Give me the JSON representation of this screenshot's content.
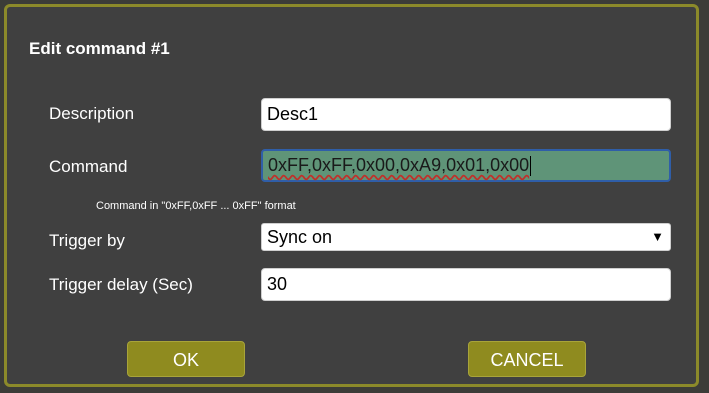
{
  "dialog": {
    "title": "Edit command #1",
    "fields": {
      "description": {
        "label": "Description",
        "value": "Desc1"
      },
      "command": {
        "label": "Command",
        "value": "0xFF,0xFF,0x00,0xA9,0x01,0x00",
        "hint": "Command in \"0xFF,0xFF ... 0xFF\" format"
      },
      "trigger_by": {
        "label": "Trigger by",
        "value": "Sync on"
      },
      "trigger_delay": {
        "label": "Trigger delay (Sec)",
        "value": "30"
      }
    },
    "buttons": {
      "ok": "OK",
      "cancel": "CANCEL"
    }
  },
  "colors": {
    "accent": "#8f8b1f",
    "dialog_bg": "#404040",
    "command_field_bg": "#5f9478",
    "focus_border": "#2f5ea8"
  },
  "icons": {
    "select_arrow": "chevron-down-icon"
  }
}
